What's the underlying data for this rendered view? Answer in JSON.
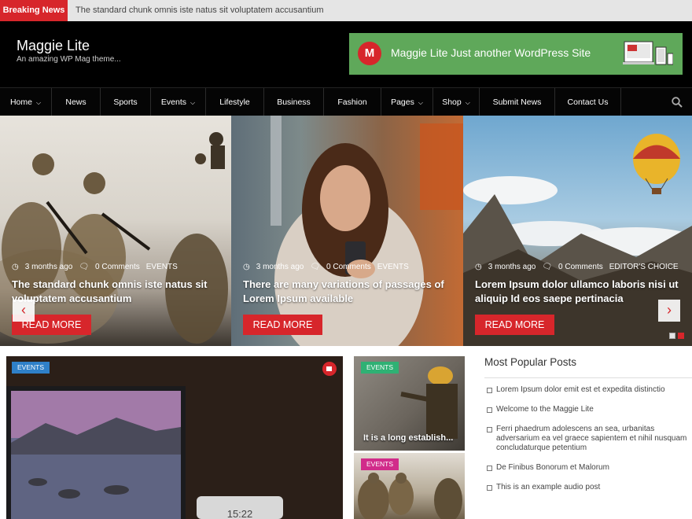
{
  "breaking": {
    "label": "Breaking News",
    "text": "The standard chunk omnis iste natus sit voluptatem accusantium"
  },
  "site": {
    "title": "Maggie Lite",
    "tagline": "An amazing WP Mag theme..."
  },
  "banner": {
    "logo_letter": "M",
    "text": "Maggie Lite Just another WordPress Site"
  },
  "nav": {
    "items": [
      {
        "label": "Home",
        "dropdown": true
      },
      {
        "label": "News",
        "dropdown": false
      },
      {
        "label": "Sports",
        "dropdown": false
      },
      {
        "label": "Events",
        "dropdown": true
      },
      {
        "label": "Lifestyle",
        "dropdown": false
      },
      {
        "label": "Business",
        "dropdown": false
      },
      {
        "label": "Fashion",
        "dropdown": false
      },
      {
        "label": "Pages",
        "dropdown": true
      },
      {
        "label": "Shop",
        "dropdown": true
      },
      {
        "label": "Submit News",
        "dropdown": false
      },
      {
        "label": "Contact Us",
        "dropdown": false
      }
    ],
    "search_icon": "search-icon"
  },
  "slider": {
    "slides": [
      {
        "time": "3 months ago",
        "comments": "0 Comments",
        "category": "EVENTS",
        "title": "The standard chunk omnis iste natus sit voluptatem accusantium",
        "button": "READ MORE"
      },
      {
        "time": "3 months ago",
        "comments": "0 Comments",
        "category": "EVENTS",
        "title": "There are many variations of passages of Lorem Ipsum available",
        "button": "READ MORE"
      },
      {
        "time": "3 months ago",
        "comments": "0 Comments",
        "category": "EDITOR'S CHOICE",
        "title": "Lorem Ipsum dolor ullamco laboris nisi ut aliquip Id eos saepe pertinacia",
        "button": "READ MORE"
      }
    ],
    "prev": "‹",
    "next": "›"
  },
  "featured": {
    "badge": "EVENTS",
    "badge_color": "#2f80c8",
    "clock": "15:22"
  },
  "side_posts": [
    {
      "badge": "EVENTS",
      "badge_color": "#2fb174",
      "caption": "It is a long establish..."
    },
    {
      "badge": "EVENTS",
      "badge_color": "#d12b8a"
    }
  ],
  "popular": {
    "heading": "Most Popular Posts",
    "items": [
      "Lorem Ipsum dolor emit est et expedita distinctio",
      "Welcome to the Maggie Lite",
      "Ferri phaedrum adolescens an sea, urbanitas adversarium ea vel graece sapientem et nihil nusquam concludaturque petentium",
      "De Finibus Bonorum et Malorum",
      "This is an example audio post"
    ]
  },
  "colors": {
    "accent": "#d7262b",
    "header_bg": "#000000",
    "banner_bg": "#5fa85a"
  }
}
